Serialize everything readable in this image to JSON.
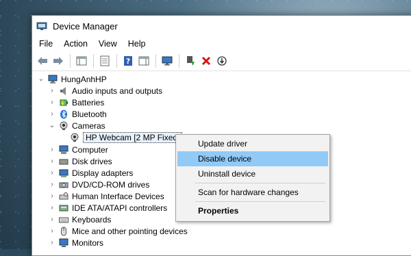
{
  "window": {
    "title": "Device Manager",
    "icon": "device-manager-icon"
  },
  "menu": [
    "File",
    "Action",
    "View",
    "Help"
  ],
  "toolbar": {
    "icons": [
      "back-arrow-icon",
      "forward-arrow-icon",
      "show-hide-console-tree-icon",
      "properties-icon",
      "help-icon",
      "action-pane-icon",
      "monitor-scan-icon",
      "update-driver-icon",
      "uninstall-icon",
      "disable-device-icon"
    ]
  },
  "tree": {
    "root": "HungAnhHP",
    "categories": [
      {
        "label": "Audio inputs and outputs",
        "icon": "speaker-icon",
        "expanded": false
      },
      {
        "label": "Batteries",
        "icon": "battery-icon",
        "expanded": false
      },
      {
        "label": "Bluetooth",
        "icon": "bluetooth-icon",
        "expanded": false
      },
      {
        "label": "Cameras",
        "icon": "camera-icon",
        "expanded": true,
        "children": [
          "HP Webcam [2 MP Fixed]"
        ]
      },
      {
        "label": "Computer",
        "icon": "computer-icon",
        "expanded": false
      },
      {
        "label": "Disk drives",
        "icon": "disk-drive-icon",
        "expanded": false
      },
      {
        "label": "Display adapters",
        "icon": "display-adapter-icon",
        "expanded": false
      },
      {
        "label": "DVD/CD-ROM drives",
        "icon": "dvd-drive-icon",
        "expanded": false
      },
      {
        "label": "Human Interface Devices",
        "icon": "hid-icon",
        "expanded": false
      },
      {
        "label": "IDE ATA/ATAPI controllers",
        "icon": "ide-controller-icon",
        "expanded": false
      },
      {
        "label": "Keyboards",
        "icon": "keyboard-icon",
        "expanded": false
      },
      {
        "label": "Mice and other pointing devices",
        "icon": "mouse-icon",
        "expanded": false
      },
      {
        "label": "Monitors",
        "icon": "monitor-icon",
        "expanded": false
      }
    ]
  },
  "context_menu": {
    "items": [
      {
        "label": "Update driver",
        "highlighted": false,
        "bold": false
      },
      {
        "label": "Disable device",
        "highlighted": true,
        "bold": false
      },
      {
        "label": "Uninstall device",
        "highlighted": false,
        "bold": false
      },
      {
        "label": "Scan for hardware changes",
        "highlighted": false,
        "bold": false
      },
      {
        "label": "Properties",
        "highlighted": false,
        "bold": true
      }
    ]
  },
  "colors": {
    "highlight": "#91c9f7",
    "menu_bg": "#f2f2f2",
    "selection_bg": "#e8f1fb"
  }
}
